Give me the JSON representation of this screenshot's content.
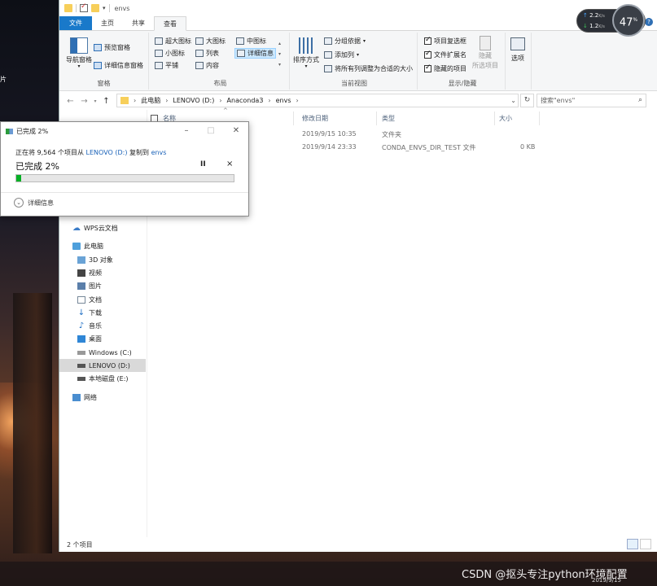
{
  "desktop": {
    "left_label": "片"
  },
  "window": {
    "title": "envs"
  },
  "tabs": [
    "文件",
    "主页",
    "共享",
    "查看"
  ],
  "ribbon": {
    "pane": {
      "nav_pane": "导航窗格",
      "preview": "预览窗格",
      "details": "详细信息窗格",
      "label": "窗格"
    },
    "layout": {
      "xl_icons": "超大图标",
      "l_icons": "大图标",
      "m_icons": "中图标",
      "s_icons": "小图标",
      "list": "列表",
      "details": "详细信息",
      "tiles": "平铺",
      "content": "内容",
      "label": "布局"
    },
    "current_view": {
      "sort": "排序方式",
      "group_by": "分组依据",
      "add_col": "添加列",
      "fit_cols": "将所有列调整为合适的大小",
      "label": "当前视图"
    },
    "show_hide": {
      "item_checkboxes": "项目复选框",
      "extensions": "文件扩展名",
      "hidden_items": "隐藏的项目",
      "hide": "隐藏",
      "hide_sub": "所选项目",
      "label": "显示/隐藏"
    },
    "options": "选项"
  },
  "address": {
    "crumbs": [
      "此电脑",
      "LENOVO (D:)",
      "Anaconda3",
      "envs"
    ],
    "search_placeholder": "搜索\"envs\""
  },
  "nav_items": [
    "WPS云文档",
    "此电脑",
    "3D 对象",
    "视频",
    "图片",
    "文档",
    "下载",
    "音乐",
    "桌面",
    "Windows (C:)",
    "LENOVO (D:)",
    "本地磁盘 (E:)",
    "网络"
  ],
  "columns": {
    "name": "名称",
    "date": "修改日期",
    "type": "类型",
    "size": "大小"
  },
  "files": [
    {
      "date": "2019/9/15 10:35",
      "type": "文件夹",
      "size": ""
    },
    {
      "date": "2019/9/14 23:33",
      "type": "CONDA_ENVS_DIR_TEST 文件",
      "size": "0 KB"
    }
  ],
  "status": {
    "count": "2 个项目"
  },
  "dialog": {
    "title": "已完成 2%",
    "line_pre": "正在将 9,564 个项目从",
    "src": "LENOVO (D:)",
    "line_mid": "复制到",
    "dst": "envs",
    "percent_text": "已完成 2%",
    "progress": 0.02,
    "pause": "II",
    "cancel": "×",
    "more": "详细信息"
  },
  "speed": {
    "up": "2.2",
    "down": "1.2",
    "unit": "K/s",
    "cpu": "47",
    "cpu_unit": "%"
  },
  "taskbar": {
    "watermark": "CSDN @抠头专注python环境配置",
    "date": "2019/9/15"
  }
}
